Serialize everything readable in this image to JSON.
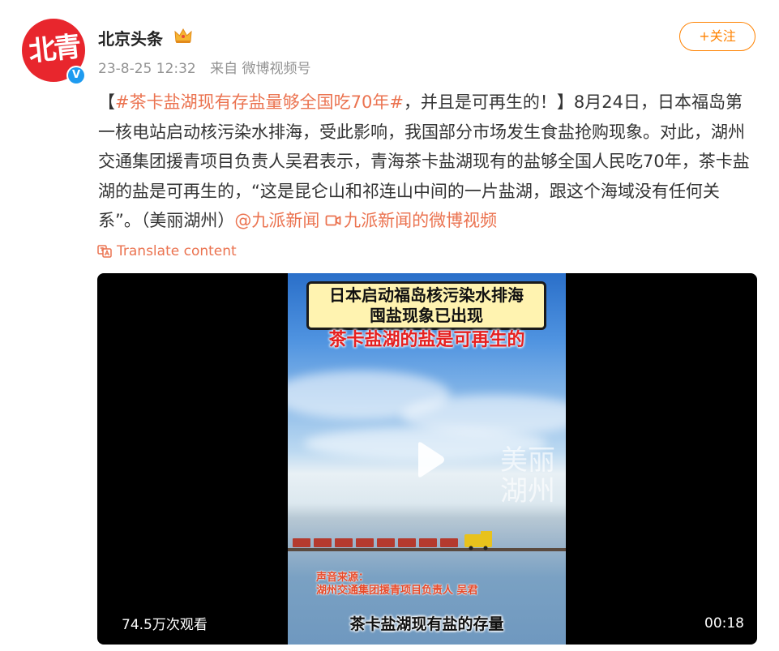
{
  "author": {
    "avatar_text": "北青",
    "name": "北京头条",
    "badge_icon": "crown-icon",
    "verified_icon": "verified-v-icon",
    "verified_mark": "V"
  },
  "meta": {
    "time": "23-8-25 12:32",
    "source": "来自 微博视频号"
  },
  "follow_label": "+关注",
  "post": {
    "bracket_open": "【",
    "hashtag": "#茶卡盐湖现有存盐量够全国吃70年#",
    "text_main": "，并且是可再生的！】8月24日，日本福岛第一核电站启动核污染水排海，受此影响，我国部分市场发生食盐抢购现象。对此，湖州交通集团援青项目负责人吴君表示，青海茶卡盐湖现有的盐够全国人民吃70年，茶卡盐湖的盐是可再生的，“这是昆仑山和祁连山中间的一片盐湖，跟这个海域没有任何关系”。（美丽湖州）",
    "mention": "@九派新闻",
    "video_link": "九派新闻的微博视频"
  },
  "translate_label": "Translate content",
  "video": {
    "title_line1": "日本启动福岛核污染水排海",
    "title_line2": "囤盐现象已出现",
    "headline": "茶卡盐湖的盐是可再生的",
    "watermark": "美丽湖州",
    "source_label": "声音来源：",
    "source_person": "湖州交通集团援青项目负责人 吴君",
    "subtitle": "茶卡盐湖现有盐的存量",
    "views": "74.5万次观看",
    "duration": "00:18"
  },
  "colors": {
    "accent": "#eb7350",
    "follow": "#ff8200",
    "avatar_bg": "#e8262d"
  }
}
